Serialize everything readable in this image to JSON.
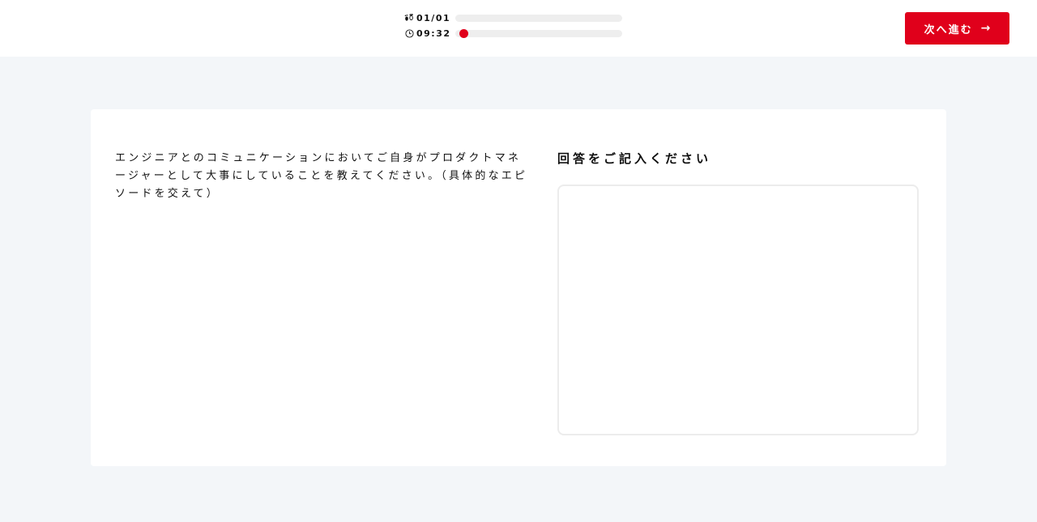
{
  "header": {
    "question_counter": "01/01",
    "timer": "09:32",
    "question_progress": 0.0,
    "time_progress": 0.03,
    "next_button": {
      "label": "次へ進む",
      "arrow": "→"
    },
    "icons": {
      "counter": "footsteps-icon",
      "timer": "clock-icon"
    }
  },
  "card": {
    "question": "エンジニアとのコミュニケーションにおいてご自身がプロダクトマネージャーとして大事にしていることを教えてください。（具体的なエピソードを交えて）",
    "answer_heading": "回答をご記入ください",
    "answer": {
      "value": "",
      "placeholder": ""
    }
  },
  "colors": {
    "accent": "#e0001b",
    "background": "#f3f6f9",
    "card": "#ffffff",
    "track": "#eeeeee"
  }
}
